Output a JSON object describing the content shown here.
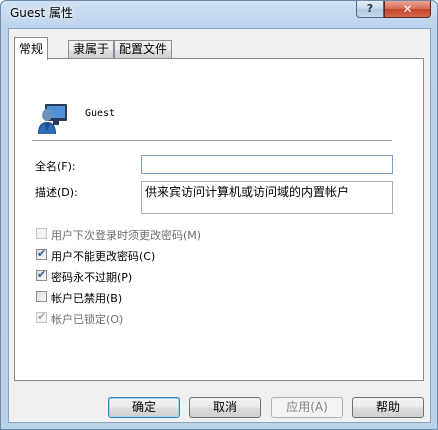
{
  "window": {
    "title": "Guest 属性",
    "help_label": "?",
    "close_label": "✕"
  },
  "tabs": [
    {
      "label": "常规",
      "active": true
    },
    {
      "label": "隶属于",
      "active": false
    },
    {
      "label": "配置文件",
      "active": false
    }
  ],
  "user": {
    "name": "Guest",
    "icon": "user-icon"
  },
  "fields": {
    "full_name_label": "全名(F):",
    "full_name_value": "",
    "description_label": "描述(D):",
    "description_value": "供来宾访问计算机或访问域的内置帐户"
  },
  "checkboxes": [
    {
      "label": "用户下次登录时须更改密码(M)",
      "checked": false,
      "disabled": true
    },
    {
      "label": "用户不能更改密码(C)",
      "checked": true,
      "disabled": false
    },
    {
      "label": "密码永不过期(P)",
      "checked": true,
      "disabled": false
    },
    {
      "label": "帐户已禁用(B)",
      "checked": false,
      "disabled": false
    },
    {
      "label": "帐户已锁定(O)",
      "checked": true,
      "disabled": true
    }
  ],
  "buttons": {
    "ok": "确定",
    "cancel": "取消",
    "apply": "应用(A)",
    "help": "帮助"
  },
  "colors": {
    "accent": "#3c7fb1",
    "close": "#c6452c",
    "title_bar": "#bcd3ec"
  }
}
